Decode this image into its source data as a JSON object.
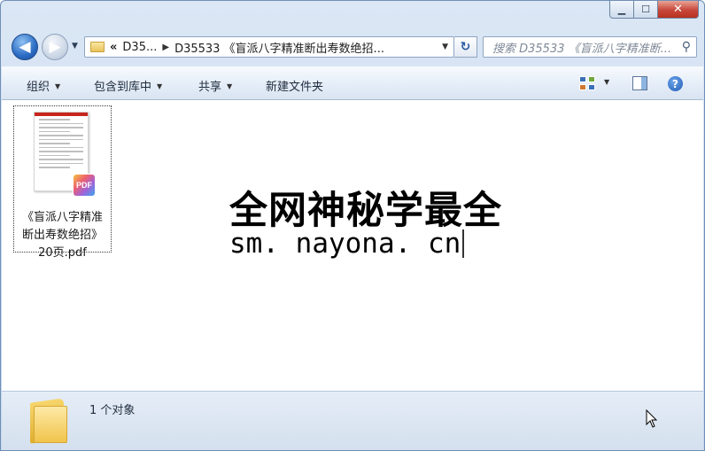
{
  "window": {
    "minimize_symbol": "▁",
    "maximize_symbol": "☐",
    "close_symbol": "✕"
  },
  "nav": {
    "back_symbol": "◀",
    "forward_symbol": "▶",
    "dropdown_symbol": "▼",
    "refresh_symbol": "↻"
  },
  "address": {
    "overflow_chevron": "«",
    "crumbs": [
      "D35...",
      "D35533 《盲派八字精准断出寿数绝招..."
    ],
    "separator": "▶",
    "dropdown_symbol": "▼"
  },
  "search": {
    "placeholder": "搜索 D35533 《盲派八字精准断...",
    "icon": "search-icon"
  },
  "toolbar": {
    "organize_label": "组织",
    "include_in_library_label": "包含到库中",
    "share_label": "共享",
    "new_folder_label": "新建文件夹",
    "help_symbol": "?"
  },
  "files": [
    {
      "name_line1": "《盲派八字精准",
      "name_line2": "断出寿数绝招》",
      "name_line3": "20页.pdf",
      "badge": "PDF",
      "thumb_header": "PDF"
    }
  ],
  "watermark": {
    "line1": "全网神秘学最全",
    "line2": "sm. nayona. cn"
  },
  "status": {
    "count_text": "1 个对象"
  }
}
